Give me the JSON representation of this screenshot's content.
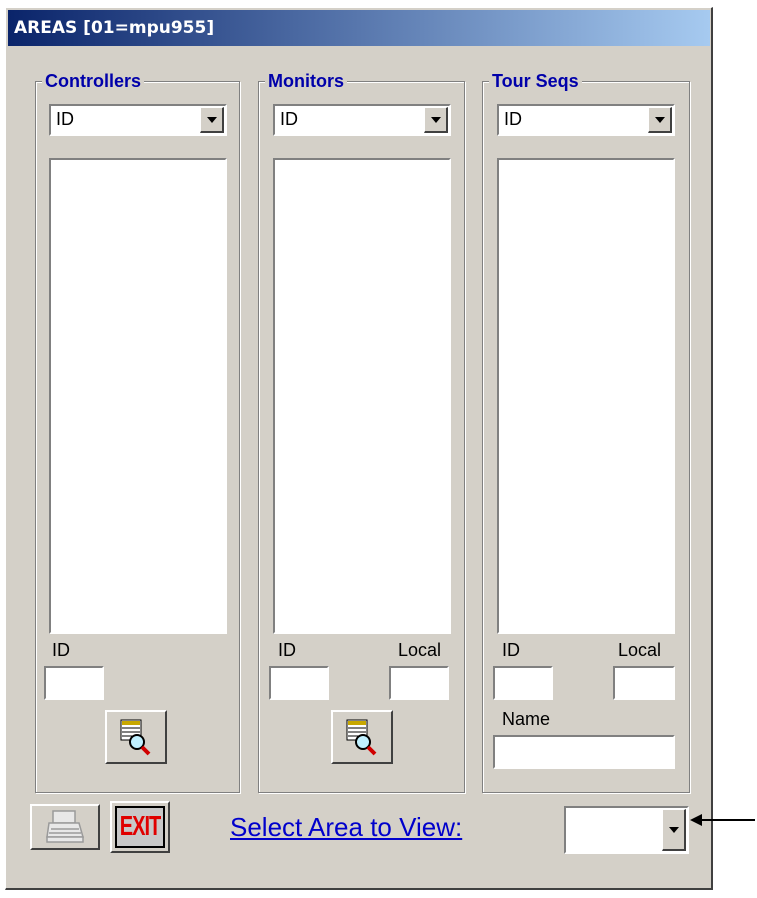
{
  "window": {
    "title": "AREAS  [01=mpu955]"
  },
  "groups": {
    "controllers": {
      "label": "Controllers",
      "sort_value": "ID",
      "id_label": "ID"
    },
    "monitors": {
      "label": "Monitors",
      "sort_value": "ID",
      "id_label": "ID",
      "local_label": "Local"
    },
    "tours": {
      "label": "Tour Seqs",
      "sort_value": "ID",
      "id_label": "ID",
      "local_label": "Local",
      "name_label": "Name"
    }
  },
  "footer": {
    "select_label": "Select Area to View:",
    "select_value": "",
    "exit_label": "EXIT"
  },
  "icons": {
    "print": "printer-icon",
    "exit": "exit-sign-icon",
    "lookup": "table-magnifier-icon",
    "arrow": "arrow-left-icon"
  }
}
